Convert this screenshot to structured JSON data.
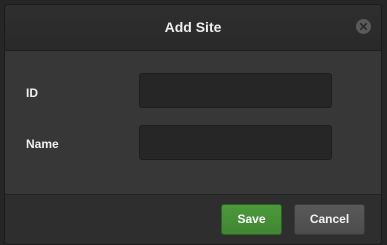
{
  "dialog": {
    "title": "Add Site",
    "close_icon": "close-icon",
    "fields": [
      {
        "label": "ID",
        "value": "",
        "placeholder": ""
      },
      {
        "label": "Name",
        "value": "",
        "placeholder": ""
      }
    ],
    "buttons": {
      "save_label": "Save",
      "cancel_label": "Cancel"
    }
  },
  "colors": {
    "save_button": "#4c9a3c",
    "cancel_button": "#595959",
    "dialog_background": "#363636"
  }
}
